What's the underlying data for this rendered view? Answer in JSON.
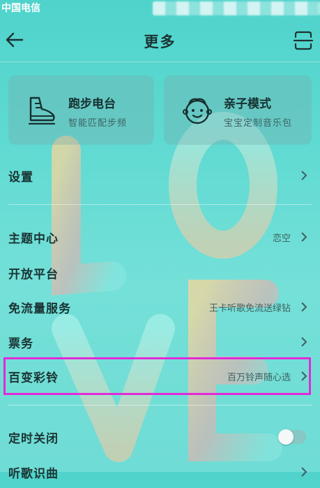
{
  "status": {
    "carrier": "中国电信"
  },
  "header": {
    "title": "更多"
  },
  "cards": [
    {
      "title": "跑步电台",
      "subtitle": "智能匹配步频",
      "icon": "running-shoe-icon"
    },
    {
      "title": "亲子模式",
      "subtitle": "宝宝定制音乐包",
      "icon": "baby-face-icon"
    }
  ],
  "menu": {
    "settings": {
      "label": "设置"
    },
    "theme": {
      "label": "主题中心",
      "value": "恋空"
    },
    "open_platform": {
      "label": "开放平台"
    },
    "free_data": {
      "label": "免流量服务",
      "value": "王卡听歌免流送绿钻"
    },
    "tickets": {
      "label": "票务"
    },
    "ringtone": {
      "label": "百变彩铃",
      "value": "百万铃声随心选"
    },
    "timer": {
      "label": "定时关闭",
      "enabled": false
    },
    "listen_log": {
      "label": "听歌识曲"
    }
  },
  "colors": {
    "highlight": "#e02ad8",
    "background": "#5fdad2"
  }
}
